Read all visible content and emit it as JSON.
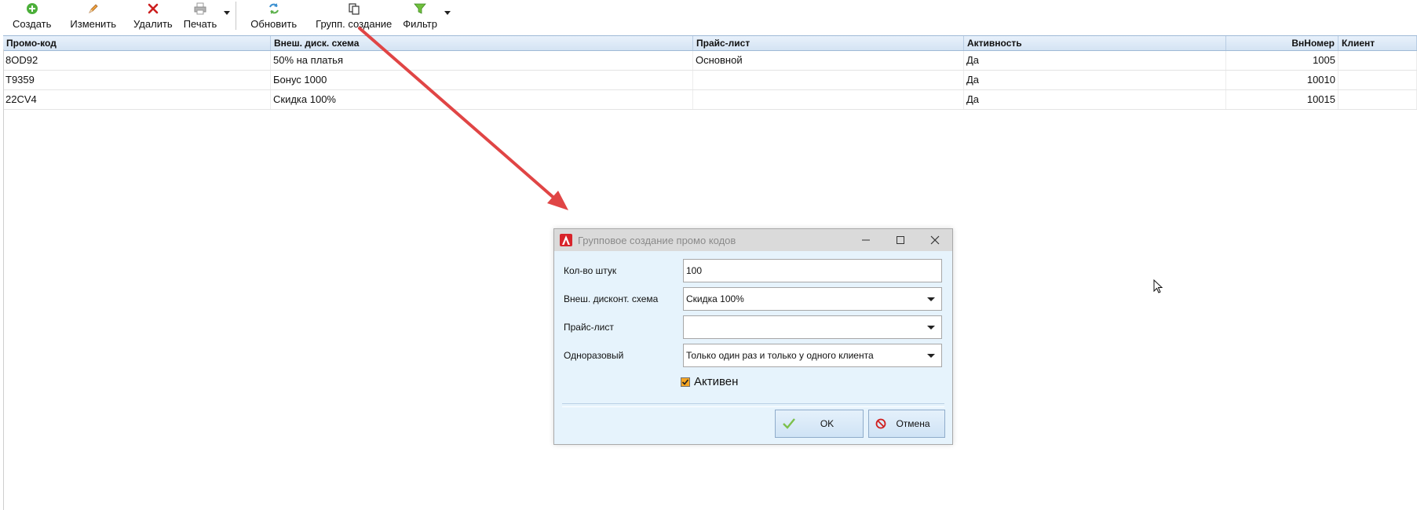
{
  "toolbar": {
    "buttons": [
      {
        "label": "Создать",
        "icon": "add-icon"
      },
      {
        "label": "Изменить",
        "icon": "edit-pencil-icon"
      },
      {
        "label": "Удалить",
        "icon": "delete-x-icon"
      },
      {
        "label": "Печать",
        "icon": "printer-icon"
      },
      {
        "label": "Обновить",
        "icon": "refresh-icon"
      },
      {
        "label": "Групп. создание",
        "icon": "copy-pages-icon"
      },
      {
        "label": "Фильтр",
        "icon": "filter-funnel-icon"
      }
    ]
  },
  "grid": {
    "columns": [
      "Промо-код",
      "Внеш. диск. схема",
      "Прайс-лист",
      "Активность",
      "ВнНомер",
      "Клиент"
    ],
    "rows": [
      {
        "code": "8OD92",
        "scheme": "50% на платья",
        "pricelist": "Основной",
        "active": "Да",
        "number": "1005",
        "client": ""
      },
      {
        "code": "T9359",
        "scheme": "Бонус 1000",
        "pricelist": "",
        "active": "Да",
        "number": "10010",
        "client": ""
      },
      {
        "code": "22CV4",
        "scheme": "Скидка 100%",
        "pricelist": "",
        "active": "Да",
        "number": "10015",
        "client": ""
      }
    ]
  },
  "dialog": {
    "title": "Групповое создание промо кодов",
    "fields": {
      "quantity": {
        "label": "Кол-во штук",
        "value": "100"
      },
      "scheme": {
        "label": "Внеш. дисконт. схема",
        "value": "Скидка 100%"
      },
      "pricelist": {
        "label": "Прайс-лист",
        "value": ""
      },
      "onetime": {
        "label": "Одноразовый",
        "value": "Только один раз и только у одного клиента"
      }
    },
    "active_checkbox": {
      "label": "Активен",
      "checked": true
    },
    "ok_label": "OK",
    "cancel_label": "Отмена"
  },
  "colors": {
    "annotation_arrow": "#e04545",
    "dialog_background": "#e6f3fc",
    "grid_header": "#d4e3f3",
    "checkbox": "#f6a623"
  }
}
